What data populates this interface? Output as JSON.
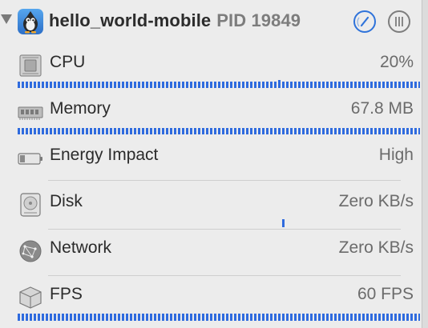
{
  "process": {
    "name": "hello_world-mobile",
    "pid_label": "PID 19849"
  },
  "colors": {
    "accent": "#2f6bde",
    "background": "#ececec"
  },
  "metrics": [
    {
      "label": "CPU",
      "value": "20%",
      "icon": "cpu-chip-icon",
      "graph": "usage-bar"
    },
    {
      "label": "Memory",
      "value": "67.8 MB",
      "icon": "memory-module-icon",
      "graph": "usage-bar"
    },
    {
      "label": "Energy Impact",
      "value": "High",
      "icon": "battery-icon",
      "graph": "none"
    },
    {
      "label": "Disk",
      "value": "Zero KB/s",
      "icon": "disk-drive-icon",
      "graph": "activity-spike"
    },
    {
      "label": "Network",
      "value": "Zero KB/s",
      "icon": "network-globe-icon",
      "graph": "none"
    },
    {
      "label": "FPS",
      "value": "60 FPS",
      "icon": "fps-cube-icon",
      "graph": "usage-bar"
    }
  ]
}
